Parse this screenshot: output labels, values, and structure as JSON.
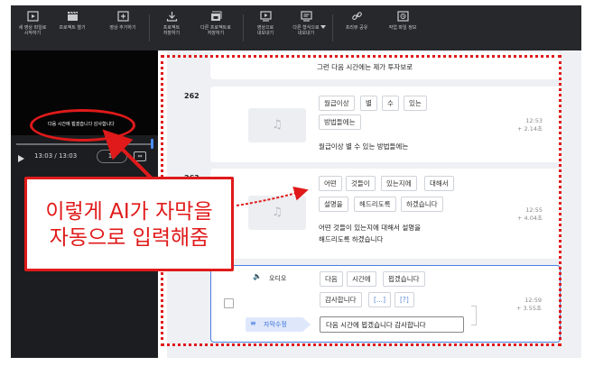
{
  "toolbar": {
    "items": [
      {
        "label": "새 영상 파일로\n시작하기",
        "icon": "new-video-icon"
      },
      {
        "label": "프로젝트 열기",
        "icon": "clapper-icon"
      },
      {
        "label": "영상 추가하기",
        "icon": "add-video-icon"
      },
      {
        "label": "프로젝트\n저장하기",
        "icon": "download-icon"
      },
      {
        "label": "다른 프로젝트로\n저장하기",
        "icon": "save-as-icon"
      },
      {
        "label": "영상으로\n내보내기",
        "icon": "export-video-icon"
      },
      {
        "label": "다른 형식으로\n내보내기",
        "icon": "export-format-icon"
      },
      {
        "label": "프리뷰 공유",
        "icon": "link-icon"
      },
      {
        "label": "작업 파일 정보",
        "icon": "file-info-icon"
      }
    ]
  },
  "player": {
    "subtitle": "다음 시간에 뵙겠습니다 감사합니다",
    "time": "13:03 / 13:03",
    "speed": "1x",
    "progress": 1.0
  },
  "rows": [
    {
      "id": "prev",
      "sentence": "그런 다음 시간에는 제가 투자보로"
    },
    {
      "id": "262",
      "number": "262",
      "chips": [
        "월급이상",
        "별",
        "수",
        "있는",
        "방법들에는"
      ],
      "sentence": "월급이상 별 수 있는 방법들에는",
      "time": "12:53",
      "duration": "+ 2.14초"
    },
    {
      "id": "263",
      "number": "263",
      "chips": [
        "어떤",
        "것들이",
        "있는지에",
        "대해서",
        "설명을",
        "해드리도록",
        "하겠습니다"
      ],
      "sentence": "어떤 것들이 있는지에 대해서 설명을\n해드리도록 하겠습니다",
      "time": "12:55",
      "duration": "+ 4.04초"
    },
    {
      "id": "264",
      "label": "오디오",
      "chips": [
        "다음",
        "시간에",
        "뵙겠습니다",
        "감사합니다",
        "[...]",
        "[?]"
      ],
      "edit_label": "자막수정",
      "edit_value": "다음 시간에 뵙겠습니다 감사합니다",
      "time": "12:59",
      "duration": "+ 3.55초"
    }
  ],
  "annotation": {
    "text": "이렇게 AI가 자막을\n자동으로 입력해줌",
    "color": "#e01a1a"
  }
}
